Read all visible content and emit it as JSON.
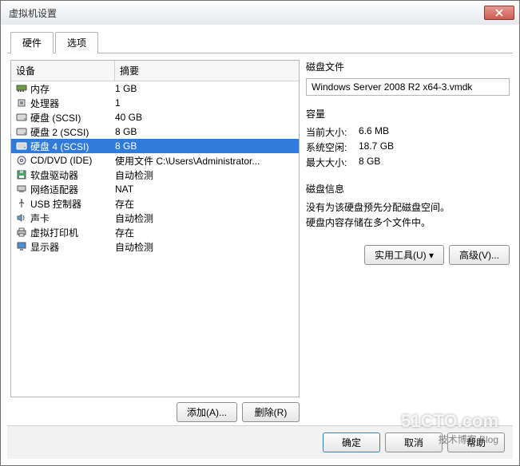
{
  "window": {
    "title": "虚拟机设置"
  },
  "tabs": {
    "hardware": "硬件",
    "options": "选项"
  },
  "list": {
    "hdr_device": "设备",
    "hdr_summary": "摘要",
    "items": [
      {
        "icon": "memory",
        "device": "内存",
        "summary": "1 GB"
      },
      {
        "icon": "cpu",
        "device": "处理器",
        "summary": "1"
      },
      {
        "icon": "hdd",
        "device": "硬盘 (SCSI)",
        "summary": "40 GB"
      },
      {
        "icon": "hdd",
        "device": "硬盘 2 (SCSI)",
        "summary": "8 GB"
      },
      {
        "icon": "hdd",
        "device": "硬盘 4 (SCSI)",
        "summary": "8 GB",
        "selected": true
      },
      {
        "icon": "cd",
        "device": "CD/DVD (IDE)",
        "summary": "使用文件 C:\\Users\\Administrator..."
      },
      {
        "icon": "floppy",
        "device": "软盘驱动器",
        "summary": "自动检测"
      },
      {
        "icon": "nic",
        "device": "网络适配器",
        "summary": "NAT"
      },
      {
        "icon": "usb",
        "device": "USB 控制器",
        "summary": "存在"
      },
      {
        "icon": "sound",
        "device": "声卡",
        "summary": "自动检测"
      },
      {
        "icon": "printer",
        "device": "虚拟打印机",
        "summary": "存在"
      },
      {
        "icon": "display",
        "device": "显示器",
        "summary": "自动检测"
      }
    ]
  },
  "left_buttons": {
    "add": "添加(A)...",
    "remove": "删除(R)"
  },
  "detail": {
    "disk_file_label": "磁盘文件",
    "disk_file_value": "Windows Server 2008 R2 x64-3.vmdk",
    "capacity_label": "容量",
    "current_size_k": "当前大小:",
    "current_size_v": "6.6 MB",
    "sys_free_k": "系统空闲:",
    "sys_free_v": "18.7 GB",
    "max_size_k": "最大大小:",
    "max_size_v": "8 GB",
    "disk_info_label": "磁盘信息",
    "disk_info_line1": "没有为该硬盘预先分配磁盘空间。",
    "disk_info_line2": "硬盘内容存储在多个文件中。",
    "util_btn": "实用工具(U)",
    "adv_btn": "高级(V)..."
  },
  "footer": {
    "ok": "确定",
    "cancel": "取消",
    "help": "帮助"
  },
  "watermark": {
    "big": "51CTO.com",
    "small": "技术博客   Blog"
  }
}
